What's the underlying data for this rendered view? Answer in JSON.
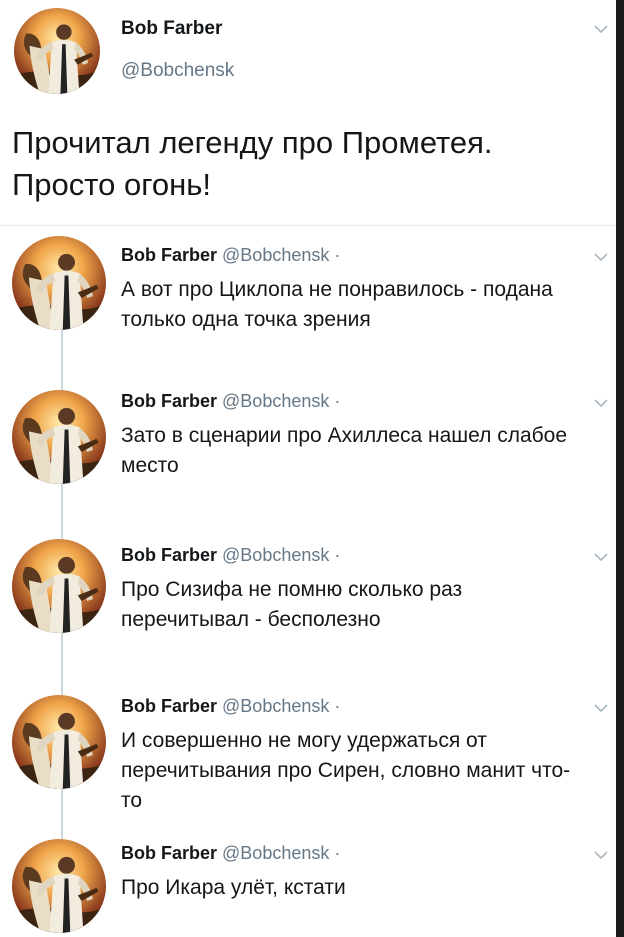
{
  "main_tweet": {
    "name": "Bob Farber",
    "handle": "@Bobchensk",
    "text": "Прочитал легенду про Прометея. Просто огонь!"
  },
  "replies": [
    {
      "name": "Bob Farber",
      "handle": "@Bobchensk ·",
      "text": "А вот про Циклопа не понравилось - подана только одна точка зрения"
    },
    {
      "name": "Bob Farber",
      "handle": "@Bobchensk ·",
      "text": "Зато в сценарии про Ахиллеса нашел слабое место"
    },
    {
      "name": "Bob Farber",
      "handle": "@Bobchensk ·",
      "text": "Про Сизифа не помню сколько раз перечитывал - бесполезно"
    },
    {
      "name": "Bob Farber",
      "handle": "@Bobchensk ·",
      "text": "И совершенно не могу удержаться от перечитывания про Сирен, словно манит что-то"
    },
    {
      "name": "Bob Farber",
      "handle": "@Bobchensk ·",
      "text": "Про Икара улёт, кстати"
    }
  ],
  "icons": {
    "menu": "chevron-down-icon",
    "avatar": "avatar-man-sunset"
  },
  "colors": {
    "text": "#14171a",
    "secondary": "#657786",
    "divider": "#e6ecf0",
    "thread_line": "#ccd6dd"
  }
}
